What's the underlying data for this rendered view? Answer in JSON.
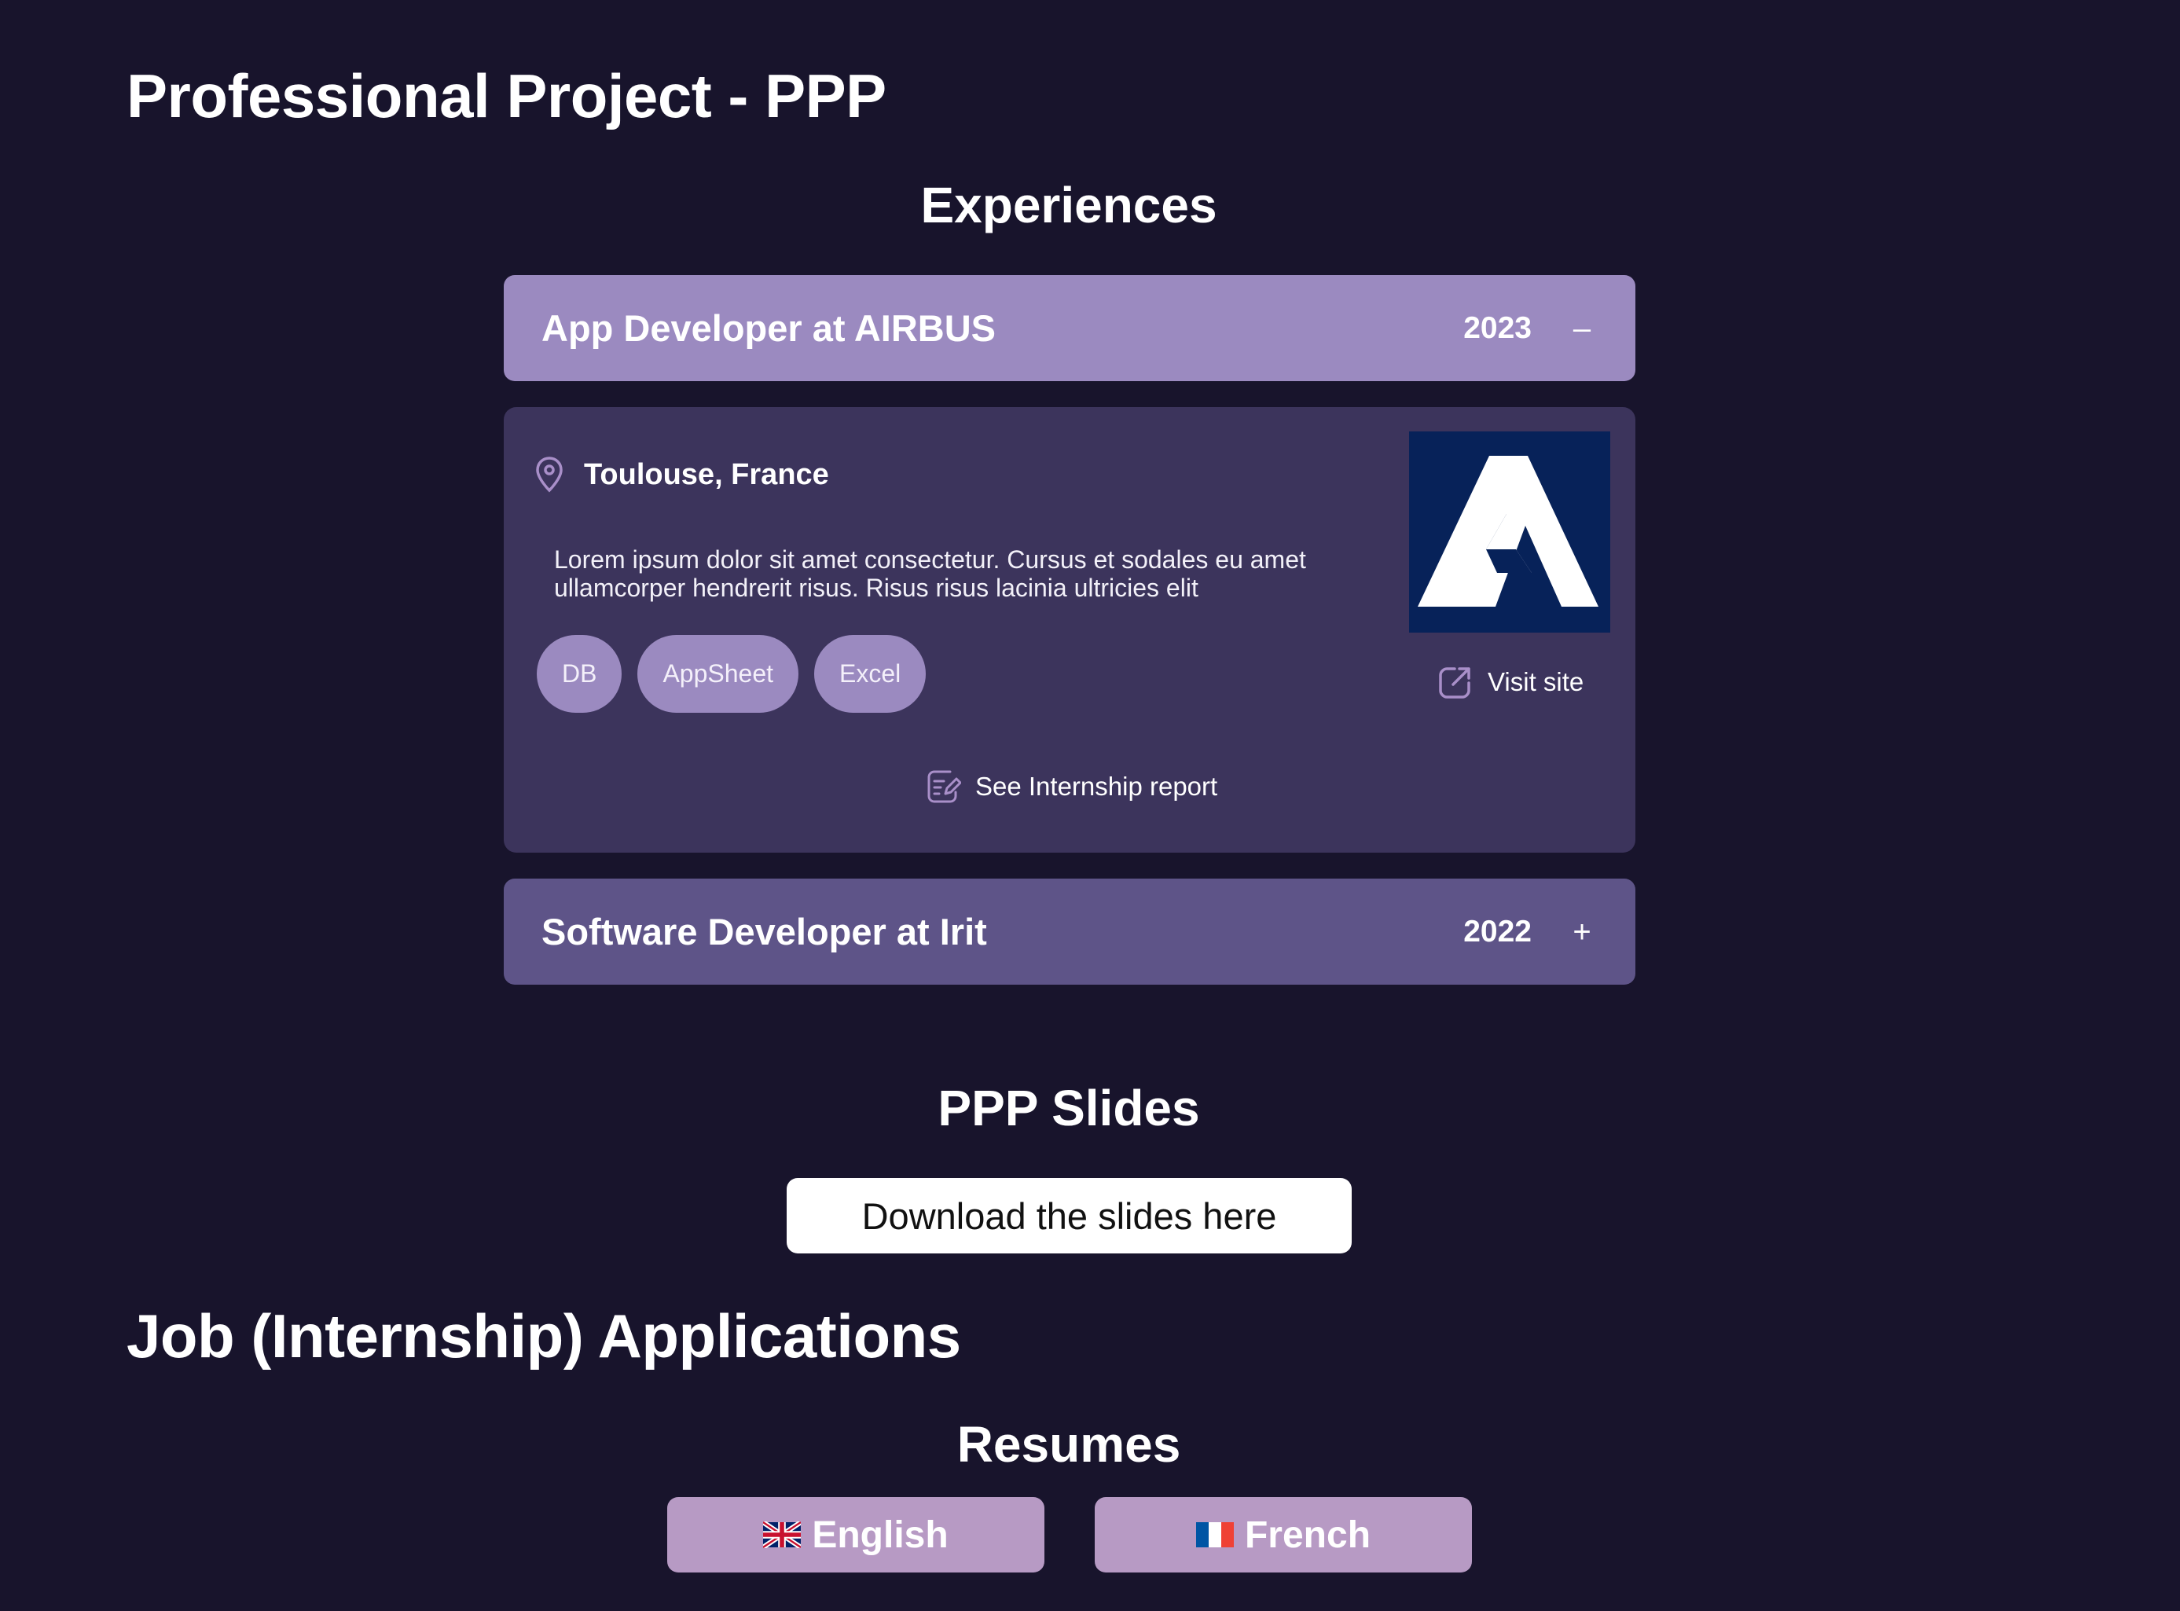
{
  "page": {
    "title": "Professional Project - PPP"
  },
  "experiences": {
    "heading": "Experiences",
    "items": [
      {
        "title": "App Developer at AIRBUS",
        "year": "2023",
        "toggle": "–",
        "expanded": true,
        "location": "Toulouse, France",
        "description": "Lorem ipsum dolor sit amet consectetur. Cursus et sodales eu amet ullamcorper hendrerit risus. Risus risus lacinia ultricies elit",
        "tags": [
          "DB",
          "AppSheet",
          "Excel"
        ],
        "visit_label": "Visit site",
        "report_label": "See Internship report",
        "logo_color": "#072259"
      },
      {
        "title": "Software Developer at Irit",
        "year": "2022",
        "toggle": "+",
        "expanded": false
      }
    ]
  },
  "slides": {
    "heading": "PPP Slides",
    "button_label": "Download the slides here"
  },
  "applications": {
    "heading": "Job (Internship) Applications",
    "resumes_heading": "Resumes",
    "languages": [
      {
        "label": "English",
        "flag": "uk-flag-icon"
      },
      {
        "label": "French",
        "flag": "france-flag-icon"
      }
    ]
  },
  "colors": {
    "background": "#18142c",
    "accordion_open": "#9b8ac0",
    "accordion_closed": "#5e5488",
    "panel": "#3c345c",
    "resume_button": "#b79ac4"
  }
}
